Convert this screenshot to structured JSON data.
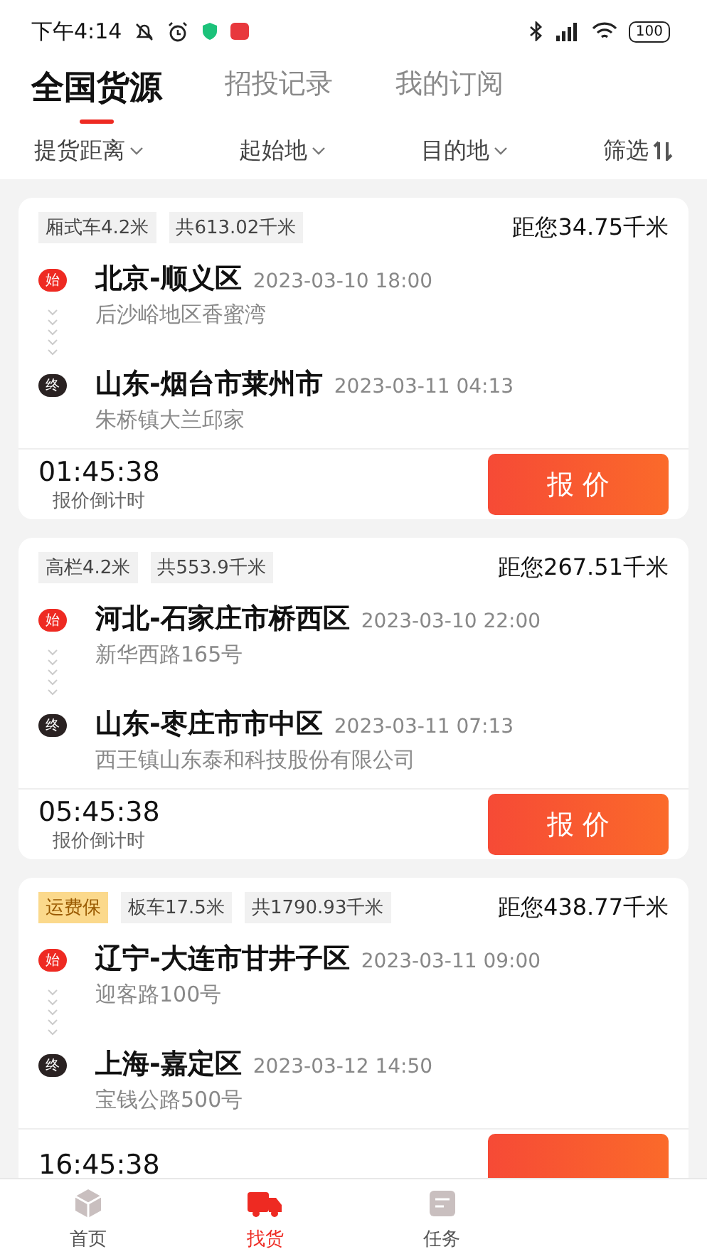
{
  "status_bar": {
    "time": "下午4:14",
    "battery": "100"
  },
  "tabs": [
    {
      "label": "全国货源",
      "selected": true
    },
    {
      "label": "招投记录",
      "selected": false
    },
    {
      "label": "我的订阅",
      "selected": false
    }
  ],
  "filters": [
    {
      "label": "提货距离",
      "kind": "dropdown"
    },
    {
      "label": "起始地",
      "kind": "dropdown"
    },
    {
      "label": "目的地",
      "kind": "dropdown"
    },
    {
      "label": "筛选",
      "kind": "sort"
    }
  ],
  "cards": [
    {
      "tags": [
        {
          "text": "厢式车4.2米",
          "kind": "plain"
        },
        {
          "text": "共613.02千米",
          "kind": "plain"
        }
      ],
      "distance": "距您34.75千米",
      "start": {
        "marker": "始",
        "place": "北京-顺义区",
        "time": "2023-03-10 18:00",
        "address": "后沙峪地区香蜜湾"
      },
      "end": {
        "marker": "终",
        "place": "山东-烟台市莱州市",
        "time": "2023-03-11 04:13",
        "address": "朱桥镇大兰邱家"
      },
      "countdown": "01:45:38",
      "countdown_label": "报价倒计时",
      "quote_button": "报 价"
    },
    {
      "tags": [
        {
          "text": "高栏4.2米",
          "kind": "plain"
        },
        {
          "text": "共553.9千米",
          "kind": "plain"
        }
      ],
      "distance": "距您267.51千米",
      "start": {
        "marker": "始",
        "place": "河北-石家庄市桥西区",
        "time": "2023-03-10 22:00",
        "address": "新华西路165号"
      },
      "end": {
        "marker": "终",
        "place": "山东-枣庄市市中区",
        "time": "2023-03-11 07:13",
        "address": "西王镇山东泰和科技股份有限公司"
      },
      "countdown": "05:45:38",
      "countdown_label": "报价倒计时",
      "quote_button": "报 价"
    },
    {
      "tags": [
        {
          "text": "运费保",
          "kind": "highlight"
        },
        {
          "text": "板车17.5米",
          "kind": "plain"
        },
        {
          "text": "共1790.93千米",
          "kind": "plain"
        }
      ],
      "distance": "距您438.77千米",
      "start": {
        "marker": "始",
        "place": "辽宁-大连市甘井子区",
        "time": "2023-03-11 09:00",
        "address": "迎客路100号"
      },
      "end": {
        "marker": "终",
        "place": "上海-嘉定区",
        "time": "2023-03-12 14:50",
        "address": "宝钱公路500号"
      },
      "countdown": "16:45:38"
    }
  ],
  "bottom_nav": [
    {
      "label": "首页",
      "kind": "home",
      "selected": false
    },
    {
      "label": "找货",
      "kind": "cargo",
      "selected": true
    },
    {
      "label": "任务",
      "kind": "tasks",
      "selected": false
    }
  ]
}
